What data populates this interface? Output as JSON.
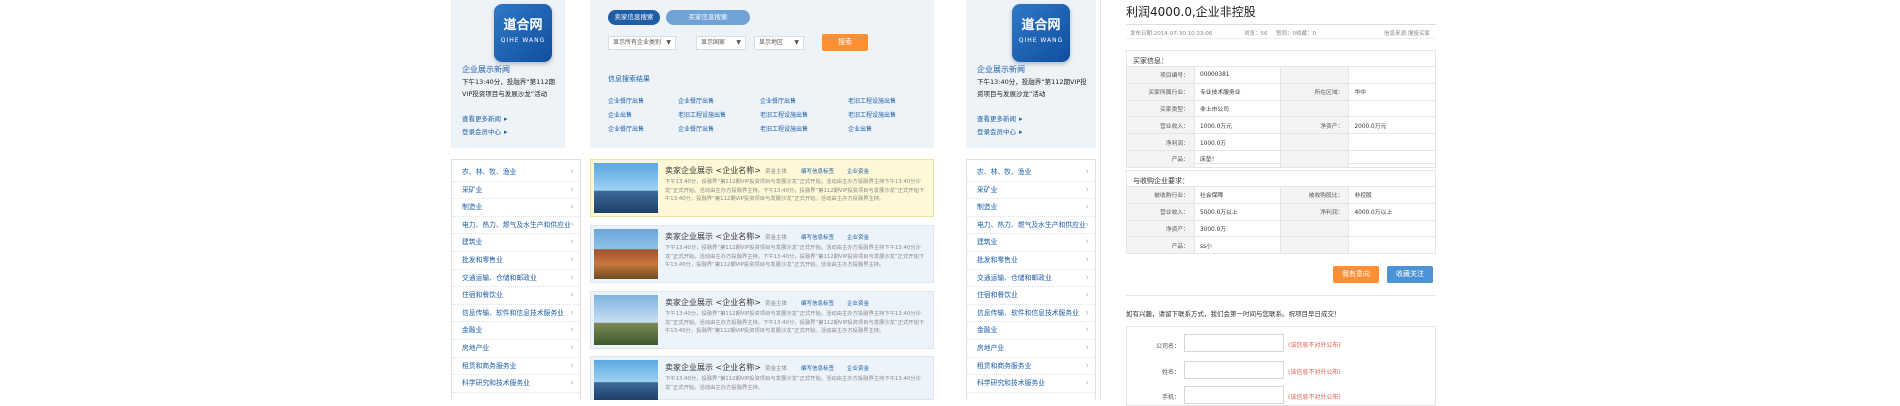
{
  "left_panel": {
    "logo": {
      "line1": "道合网",
      "line2": "QIHE WANG"
    },
    "news_title": "企业展示新闻",
    "news_body": "下午13:40分，投融界“第112期VIP投资项目与发展沙龙”活动",
    "links": [
      "查看更多新闻",
      "登录会员中心"
    ]
  },
  "search": {
    "tabs": [
      "卖家信息搜索",
      "买家信息搜索"
    ],
    "selects": [
      "显示所有企业类别",
      "显示国家",
      "显示地区"
    ],
    "button": "搜索",
    "results_title": "信息搜索结果",
    "results": [
      [
        "企业餐厅出售",
        "企业餐厅出售",
        "企业餐厅出售",
        "老旧工程设施出售"
      ],
      [
        "企业出售",
        "老旧工程设施出售",
        "老旧工程设施出售",
        "老旧工程设施出售"
      ],
      [
        "企业餐厅出售",
        "企业餐厅出售",
        "老旧工程设施出售",
        "企业出售"
      ]
    ]
  },
  "categories": [
    "农、林、牧、渔业",
    "采矿业",
    "制造业",
    "电力、热力、燃气及水生产和供应业",
    "建筑业",
    "批发和零售业",
    "交通运输、仓储和邮政业",
    "住宿和餐饮业",
    "信息传输、软件和信息技术服务业",
    "金融业",
    "房地产业",
    "租赁和商务服务业",
    "科学研究和技术服务业"
  ],
  "cards": [
    {
      "name": "卖家企业展示  <企业名称>",
      "tags": [
        "资金主体",
        "编写信息标签",
        "企业资金"
      ],
      "desc": "下午13:40分，投融界“第112期VIP投资项目与发展沙龙”正式开始。活动由主办方投融界主持下午13:40分沙龙”正式开始。活动由主办方投融界主持。下午13:40分，投融界“第112期VIP投资项目与发展沙龙”正式开始下午13:40分，投融界“第112期VIP投资项目与发展沙龙”正式开始。活动由主办方投融界主持。"
    },
    {
      "name": "卖家企业展示  <企业名称>",
      "tags": [
        "资金主体",
        "编写信息标签",
        "企业资金"
      ],
      "desc": "下午13:40分，投融界“第112期VIP投资项目与发展沙龙”正式开始。活动由主办方投融界主持下午13:40分沙龙”正式开始。活动由主办方投融界主持。下午13:40分，投融界“第112期VIP投资项目与发展沙龙”正式开始下午13:40分，投融界“第112期VIP投资项目与发展沙龙”正式开始。活动由主办方投融界主持。"
    },
    {
      "name": "卖家企业展示  <企业名称>",
      "tags": [
        "资金主体",
        "编写信息标签",
        "企业资金"
      ],
      "desc": "下午13:40分，投融界“第112期VIP投资项目与发展沙龙”正式开始。活动由主办方投融界主持下午13:40分沙龙”正式开始。活动由主办方投融界主持。下午13:40分，投融界“第112期VIP投资项目与发展沙龙”正式开始下午13:40分，投融界“第112期VIP投资项目与发展沙龙”正式开始。活动由主办方投融界主持。"
    },
    {
      "name": "卖家企业展示  <企业名称>",
      "tags": [
        "资金主体",
        "编写信息标签",
        "企业资金"
      ],
      "desc": "下午13:40分，投融界“第112期VIP投资项目与发展沙龙”正式开始。活动由主办方投融界主持下午13:40分沙龙”正式开始。活动由主办方投融界主持。"
    }
  ],
  "detail": {
    "title": "利润4000.0,企业非控股",
    "published": "发布日期:2014-07-30 10:33:06",
    "views": "浏览：56",
    "likes": "赞同：0",
    "collects": "收藏：0",
    "source": "信息来源:搜投买家",
    "buyer_section": "买家信息：",
    "buyer_rows": [
      [
        "项目编号：",
        "00000381",
        "",
        ""
      ],
      [
        "买家所属行业：",
        "专业技术服务业",
        "所在区域：",
        "华中"
      ],
      [
        "买家类型：",
        "非上市公司",
        "",
        ""
      ],
      [
        "营业收入：",
        "1000.0万元",
        "净资产：",
        "2000.0万元"
      ],
      [
        "净利润：",
        "1000.0万",
        "",
        ""
      ],
      [
        "产品：",
        "床垫！",
        "",
        ""
      ]
    ],
    "target_section": "与收购企业要求：",
    "target_rows": [
      [
        "被收购行业：",
        "社会保障",
        "被收购股比：",
        "非控股"
      ],
      [
        "营业收入：",
        "5000.0万以上",
        "净利润：",
        "4000.0万以上"
      ],
      [
        "净资产：",
        "3000.0万",
        "",
        ""
      ],
      [
        "产品：",
        "ss小",
        "",
        ""
      ]
    ],
    "btn_intent": "我有意向",
    "btn_follow": "收藏关注",
    "contact_prompt": "如有兴趣，请留下联系方式，我们会第一时间与您联系。祝项目早日成交！",
    "form_labels": [
      "公司名：",
      "姓名：",
      "手机："
    ],
    "form_note": "(该信息不对外公布)"
  },
  "colors": {
    "accent_blue": "#1e5fa8",
    "orange": "#ff8f33",
    "panel_bg": "#eef3f8"
  }
}
